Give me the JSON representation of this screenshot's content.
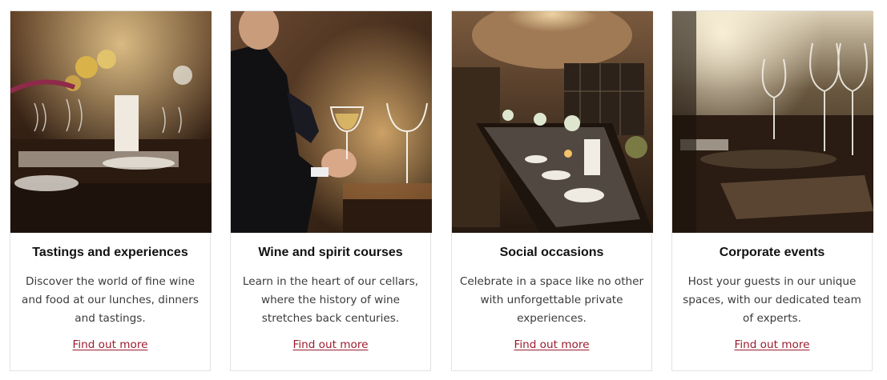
{
  "cards": [
    {
      "title": "Tastings and experiences",
      "description": "Discover the world of fine wine and food at our lunches, dinners and tastings.",
      "link": "Find out more"
    },
    {
      "title": "Wine and spirit courses",
      "description": "Learn in the heart of our cellars, where the history of wine stretches back centuries.",
      "link": "Find out more"
    },
    {
      "title": "Social occasions",
      "description": "Celebrate in a space like no other with unforgettable private experiences.",
      "link": "Find out more"
    },
    {
      "title": "Corporate events",
      "description": "Host your guests in our unique spaces, with our dedicated team of experts.",
      "link": "Find out more"
    }
  ],
  "colors": {
    "link": "#9b1b2e",
    "title": "#111111",
    "body": "#3a3a3a",
    "border": "#e2e2e2"
  }
}
